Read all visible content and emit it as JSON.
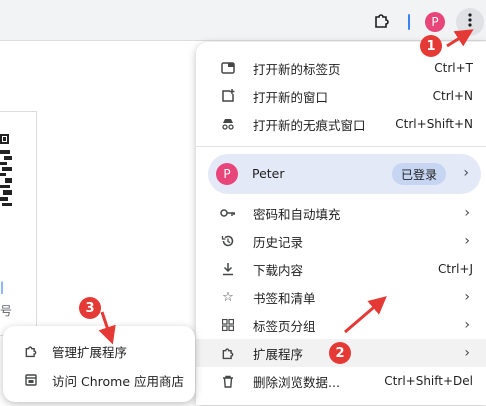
{
  "toolbar": {
    "extensions_icon": "puzzle-icon",
    "profile_initial": "P",
    "menu_icon": "kebab-icon"
  },
  "menu": {
    "items_top": [
      {
        "label": "打开新的标签页",
        "shortcut": "Ctrl+T",
        "icon": "new-tab-icon"
      },
      {
        "label": "打开新的窗口",
        "shortcut": "Ctrl+N",
        "icon": "new-window-icon"
      },
      {
        "label": "打开新的无痕式窗口",
        "shortcut": "Ctrl+Shift+N",
        "icon": "incognito-icon"
      }
    ],
    "profile": {
      "initial": "P",
      "name": "Peter",
      "status": "已登录"
    },
    "items_mid": [
      {
        "label": "密码和自动填充",
        "icon": "key-icon"
      },
      {
        "label": "历史记录",
        "icon": "history-icon"
      },
      {
        "label": "下载内容",
        "shortcut": "Ctrl+J",
        "icon": "download-icon"
      },
      {
        "label": "书签和清单",
        "icon": "star-icon"
      },
      {
        "label": "标签页分组",
        "icon": "grid-icon"
      },
      {
        "label": "扩展程序",
        "icon": "puzzle-icon"
      },
      {
        "label": "删除浏览数据...",
        "shortcut": "Ctrl+Shift+Del",
        "icon": "trash-icon"
      }
    ]
  },
  "submenu": {
    "items": [
      {
        "label": "管理扩展程序",
        "icon": "puzzle-icon"
      },
      {
        "label": "访问 Chrome 应用商店",
        "icon": "store-icon"
      }
    ]
  },
  "annotations": [
    "1",
    "2",
    "3"
  ],
  "annotation_color": "#e53935"
}
